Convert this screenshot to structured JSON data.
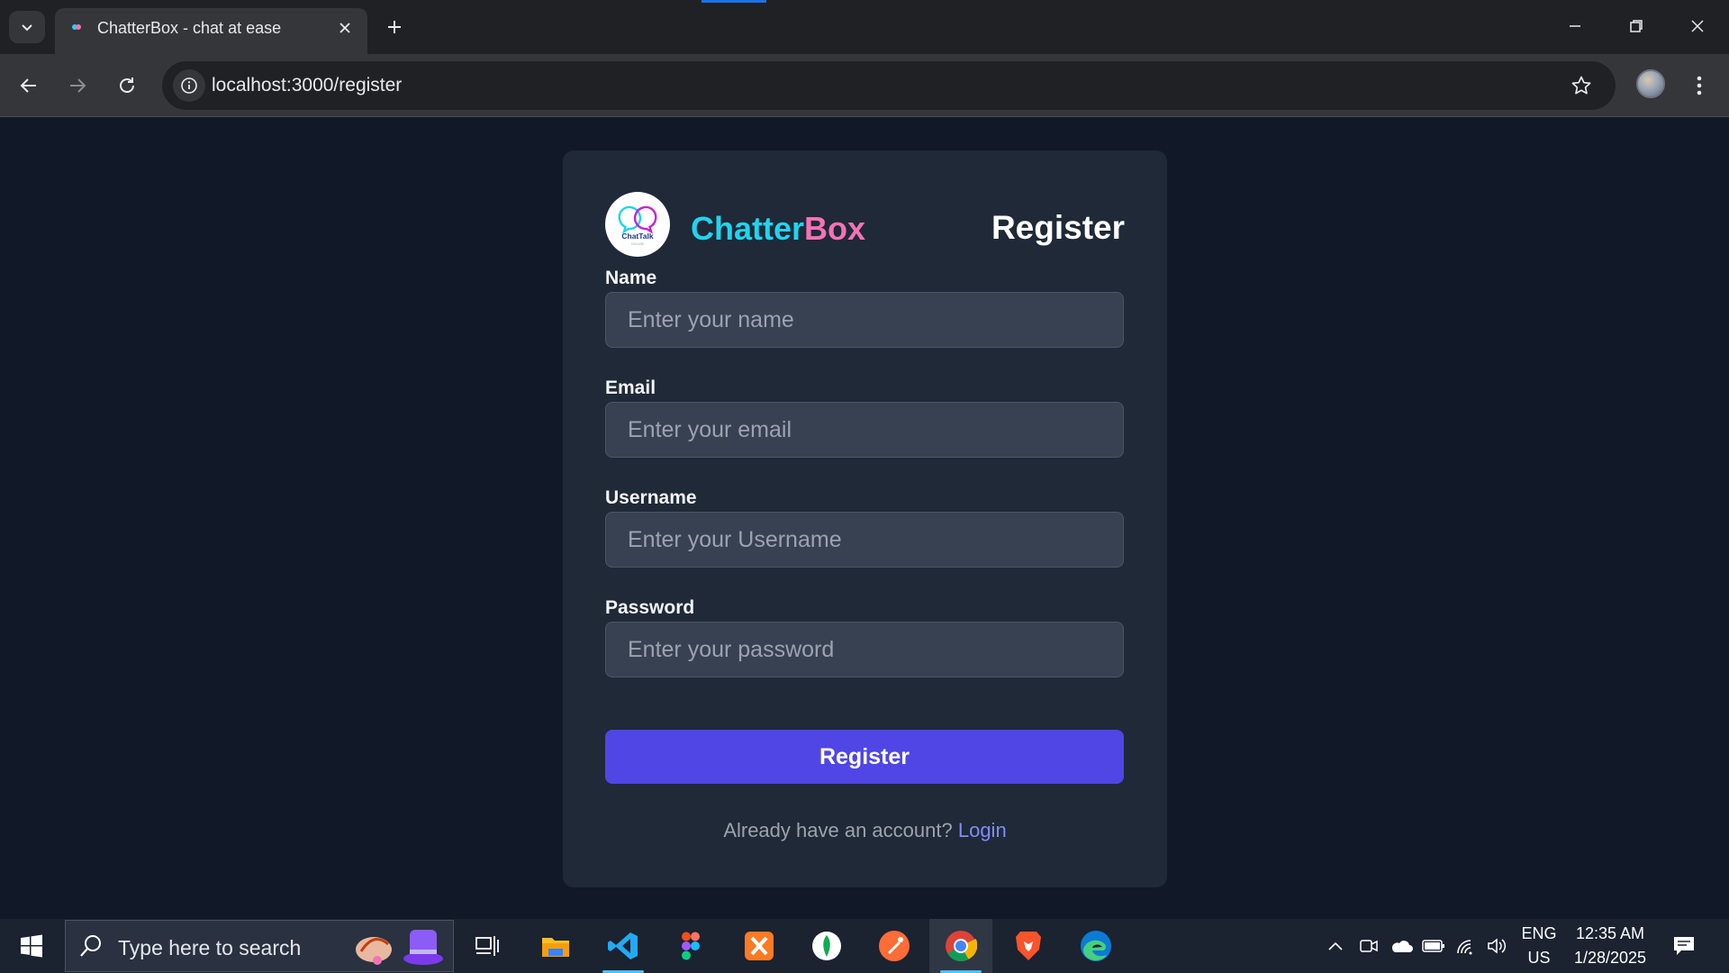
{
  "browser": {
    "tab_title": "ChatterBox - chat at ease",
    "url": "localhost:3000/register"
  },
  "brand": {
    "name_part1": "Chatter",
    "name_part2": "Box",
    "logo_text": "ChatTalk",
    "logo_subtext": "TAGLINE"
  },
  "form": {
    "heading": "Register",
    "fields": [
      {
        "label": "Name",
        "placeholder": "Enter your name",
        "value": ""
      },
      {
        "label": "Email",
        "placeholder": "Enter your email",
        "value": ""
      },
      {
        "label": "Username",
        "placeholder": "Enter your Username",
        "value": ""
      },
      {
        "label": "Password",
        "placeholder": "Enter your password",
        "value": ""
      }
    ],
    "submit_label": "Register",
    "footer_text": "Already have an account?",
    "login_link": "Login"
  },
  "taskbar": {
    "search_placeholder": "Type here to search",
    "apps": [
      "task-view",
      "file-explorer",
      "vscode",
      "figma",
      "xampp",
      "mongodb-compass",
      "postman",
      "chrome",
      "brave",
      "edge"
    ],
    "language": "ENG",
    "region": "US",
    "time": "12:35 AM",
    "date": "1/28/2025"
  },
  "colors": {
    "page_bg": "#111827",
    "card_bg": "#1f2937",
    "input_bg": "#374151",
    "brand_cyan": "#22d3ee",
    "brand_pink": "#f472b6",
    "button": "#4f46e5",
    "link": "#818cf8"
  }
}
